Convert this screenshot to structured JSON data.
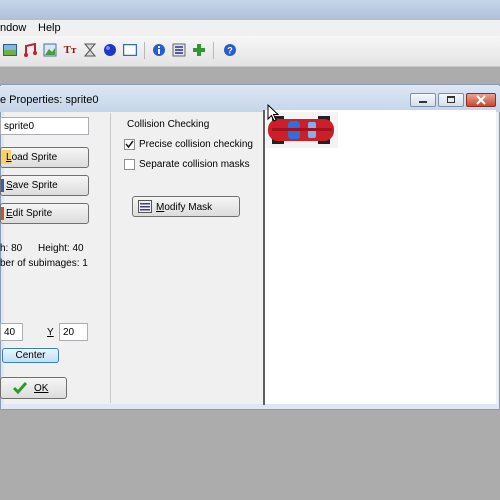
{
  "menu": {
    "items": [
      "ndow",
      "Help"
    ]
  },
  "toolbar": {
    "icons": [
      "image-icon",
      "sound-icon",
      "background-icon",
      "font-icon",
      "timeline-icon",
      "object-icon",
      "room-icon",
      "info-icon",
      "settings-icon",
      "add-icon",
      "help-icon"
    ]
  },
  "dialog": {
    "title": "e Properties: sprite0",
    "name_value": "sprite0",
    "load_sprite": {
      "hot": "L",
      "rest": "oad Sprite"
    },
    "save_sprite": {
      "hot": "S",
      "rest": "ave Sprite"
    },
    "edit_sprite": {
      "hot": "E",
      "rest": "dit Sprite"
    },
    "width_text": "h: 80",
    "height_text": "Height: 40",
    "subimages_text": "ber of subimages: 1",
    "x_value": "40",
    "y_label": "Y",
    "y_value": "20",
    "center_button": "Center",
    "ok_button": "OK",
    "collision": {
      "group_title": "Collision Checking",
      "precise": {
        "label": "Precise collision checking",
        "checked": true
      },
      "separate": {
        "label": "Separate collision masks",
        "checked": false
      },
      "modify_mask": {
        "hot": "M",
        "rest": "odify Mask"
      }
    }
  },
  "colors": {
    "car_red": "#cc1f2a",
    "ok_check": "#2e9a2e"
  }
}
